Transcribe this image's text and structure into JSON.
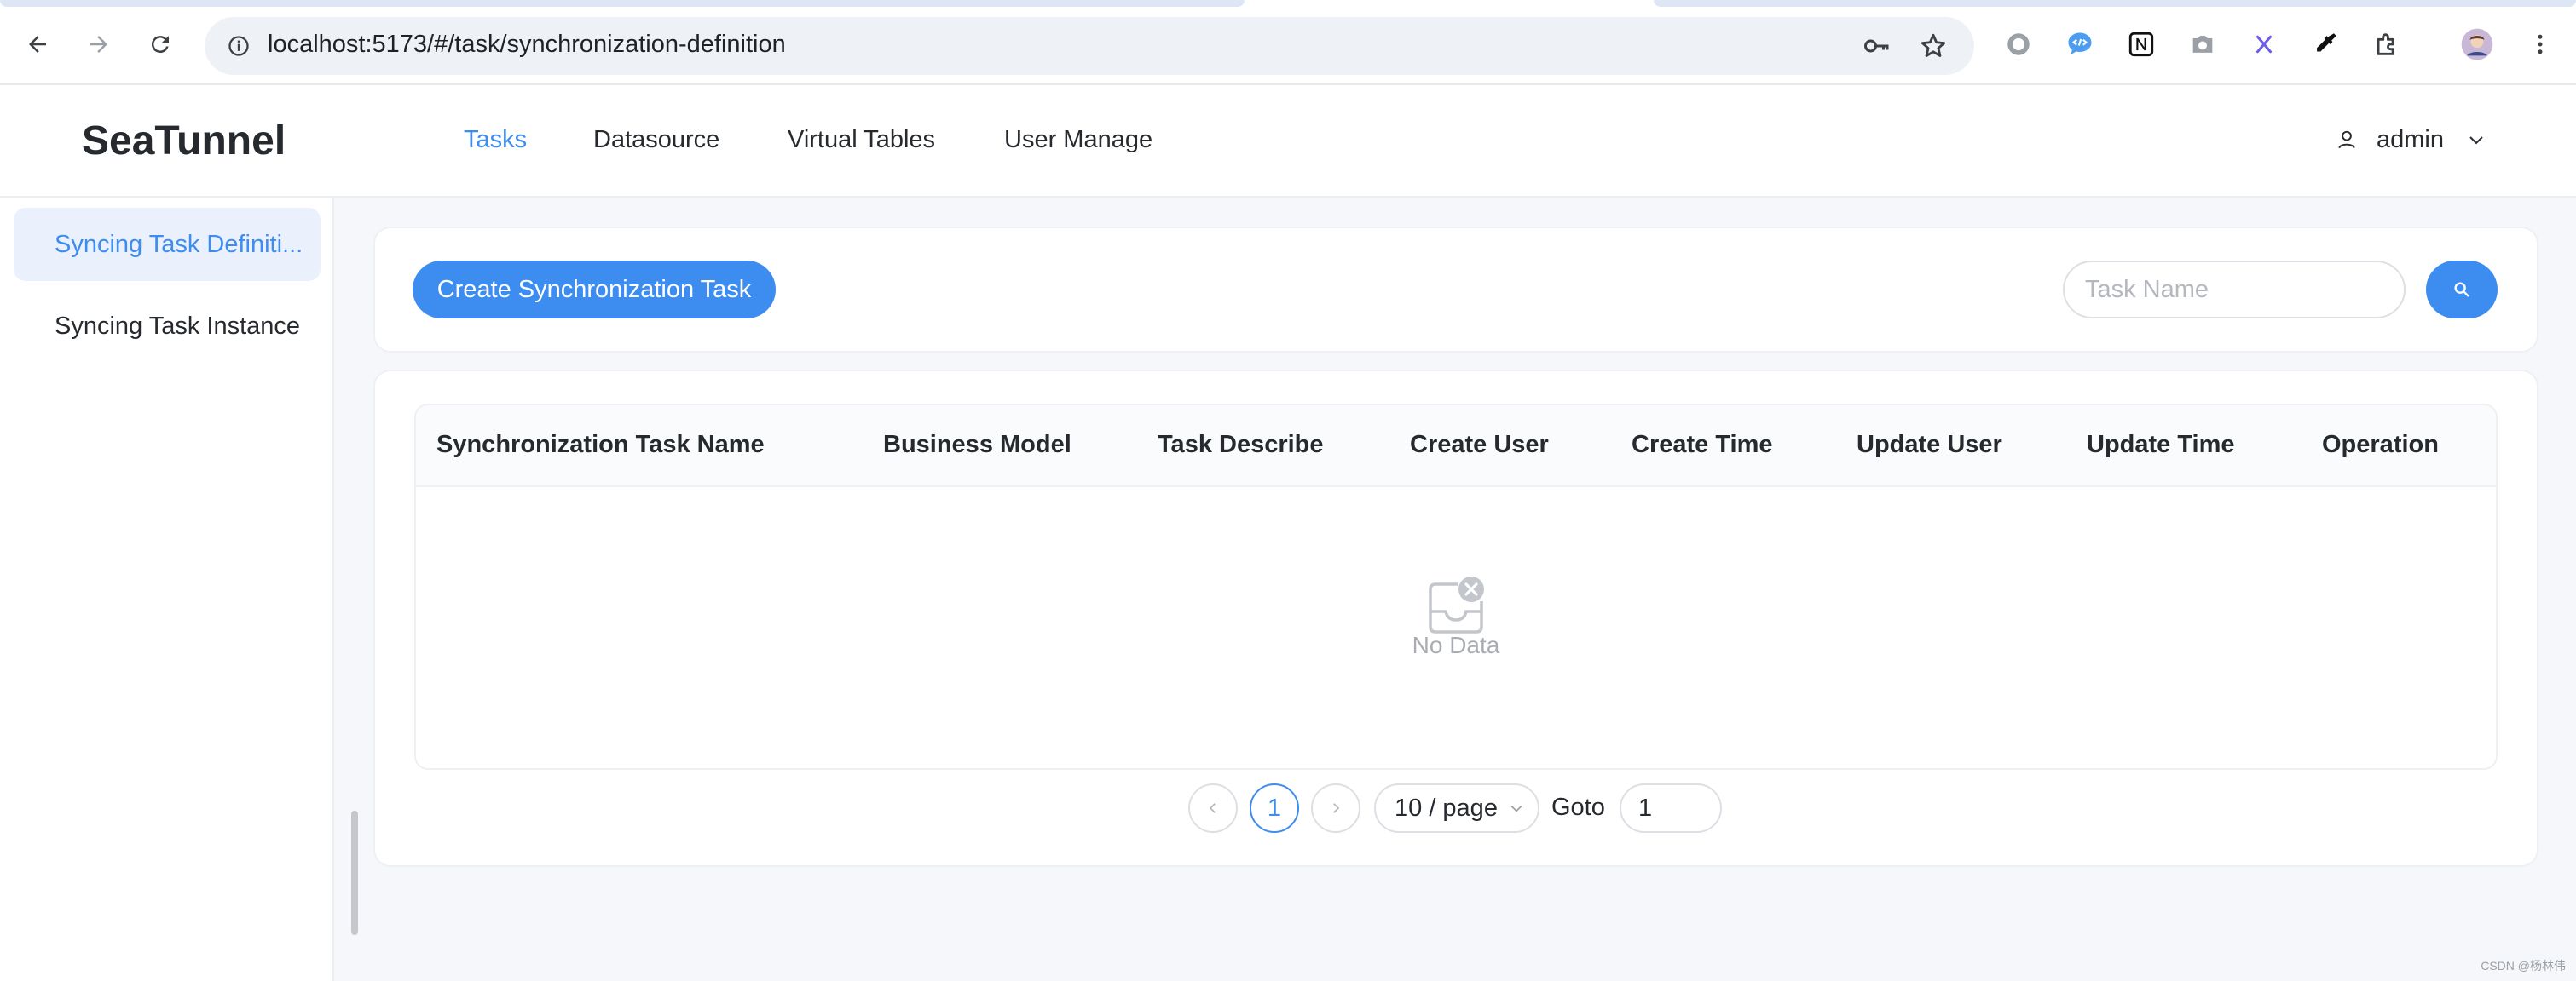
{
  "browser": {
    "url": "localhost:5173/#/task/synchronization-definition",
    "nav_icons": [
      "back-icon",
      "forward-icon",
      "reload-icon"
    ],
    "omnibox_icons": [
      "info-icon",
      "key-icon",
      "star-icon"
    ],
    "extension_icons": [
      "record-icon",
      "code-icon",
      "notion-icon",
      "camera-icon",
      "x-icon",
      "eyedropper-icon",
      "puzzle-icon",
      "profile-avatar",
      "kebab-menu-icon"
    ]
  },
  "header": {
    "logo": "SeaTunnel",
    "nav": [
      {
        "label": "Tasks",
        "active": true
      },
      {
        "label": "Datasource",
        "active": false
      },
      {
        "label": "Virtual Tables",
        "active": false
      },
      {
        "label": "User Manage",
        "active": false
      }
    ],
    "user": "admin"
  },
  "sidebar": {
    "items": [
      {
        "label": "Syncing Task Definiti...",
        "active": true
      },
      {
        "label": "Syncing Task Instance",
        "active": false
      }
    ]
  },
  "toolbar": {
    "create_label": "Create Synchronization Task",
    "search_placeholder": "Task Name"
  },
  "table": {
    "columns": [
      "Synchronization Task Name",
      "Business Model",
      "Task Describe",
      "Create User",
      "Create Time",
      "Update User",
      "Update Time",
      "Operation"
    ],
    "rows": [],
    "empty_text": "No Data"
  },
  "pagination": {
    "current_page": "1",
    "page_size": "10 / page",
    "goto_label": "Goto",
    "goto_value": "1"
  },
  "colors": {
    "accent": "#3d8cf0",
    "active_bg": "#eaf1fc"
  },
  "watermark": "CSDN @杨林伟"
}
